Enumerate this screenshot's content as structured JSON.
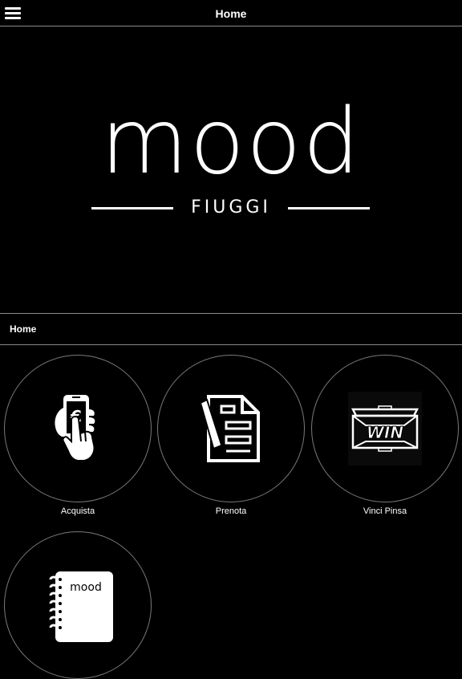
{
  "header": {
    "title": "Home",
    "menu_icon": "hamburger-menu-icon"
  },
  "hero": {
    "logo_word": "mood",
    "logo_city": "FIUGGI"
  },
  "section": {
    "title": "Home"
  },
  "tiles": [
    {
      "label": "Acquista",
      "icon": "mobile-payment-icon"
    },
    {
      "label": "Prenota",
      "icon": "document-pen-icon"
    },
    {
      "label": "Vinci Pinsa",
      "icon": "win-pizza-box-icon"
    },
    {
      "label": "",
      "icon": "mood-notebook-icon",
      "notebook_text": "mood"
    }
  ],
  "colors": {
    "background": "#000000",
    "foreground": "#ffffff",
    "divider": "#8a8a8a"
  }
}
